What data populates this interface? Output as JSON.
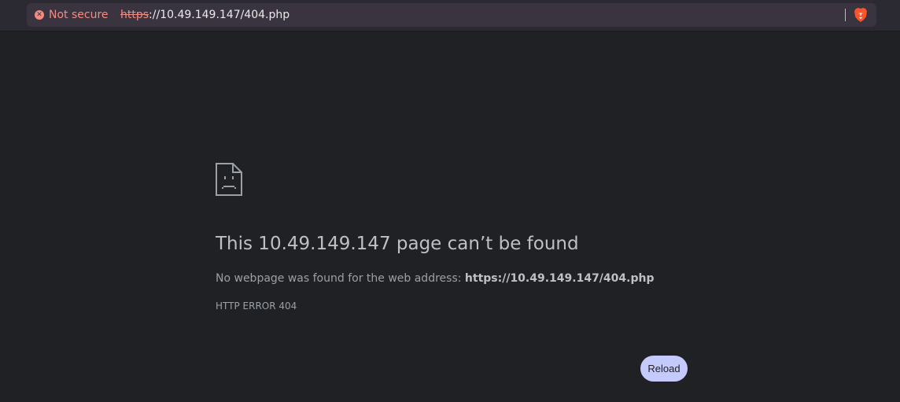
{
  "address_bar": {
    "security_label": "Not secure",
    "url_scheme": "https",
    "url_rest": "://10.49.149.147/404.php"
  },
  "error_page": {
    "title": "This 10.49.149.147 page can’t be found",
    "description_prefix": "No webpage was found for the web address: ",
    "description_url": "https://10.49.149.147/404.php",
    "error_code": "HTTP ERROR 404",
    "reload_label": "Reload"
  },
  "icons": {
    "security": "close-circle-icon",
    "browser": "brave-lion-icon",
    "error": "sad-document-icon"
  },
  "colors": {
    "page_background": "#202124",
    "warning": "#f28b82",
    "button_background": "#c5cafc"
  }
}
